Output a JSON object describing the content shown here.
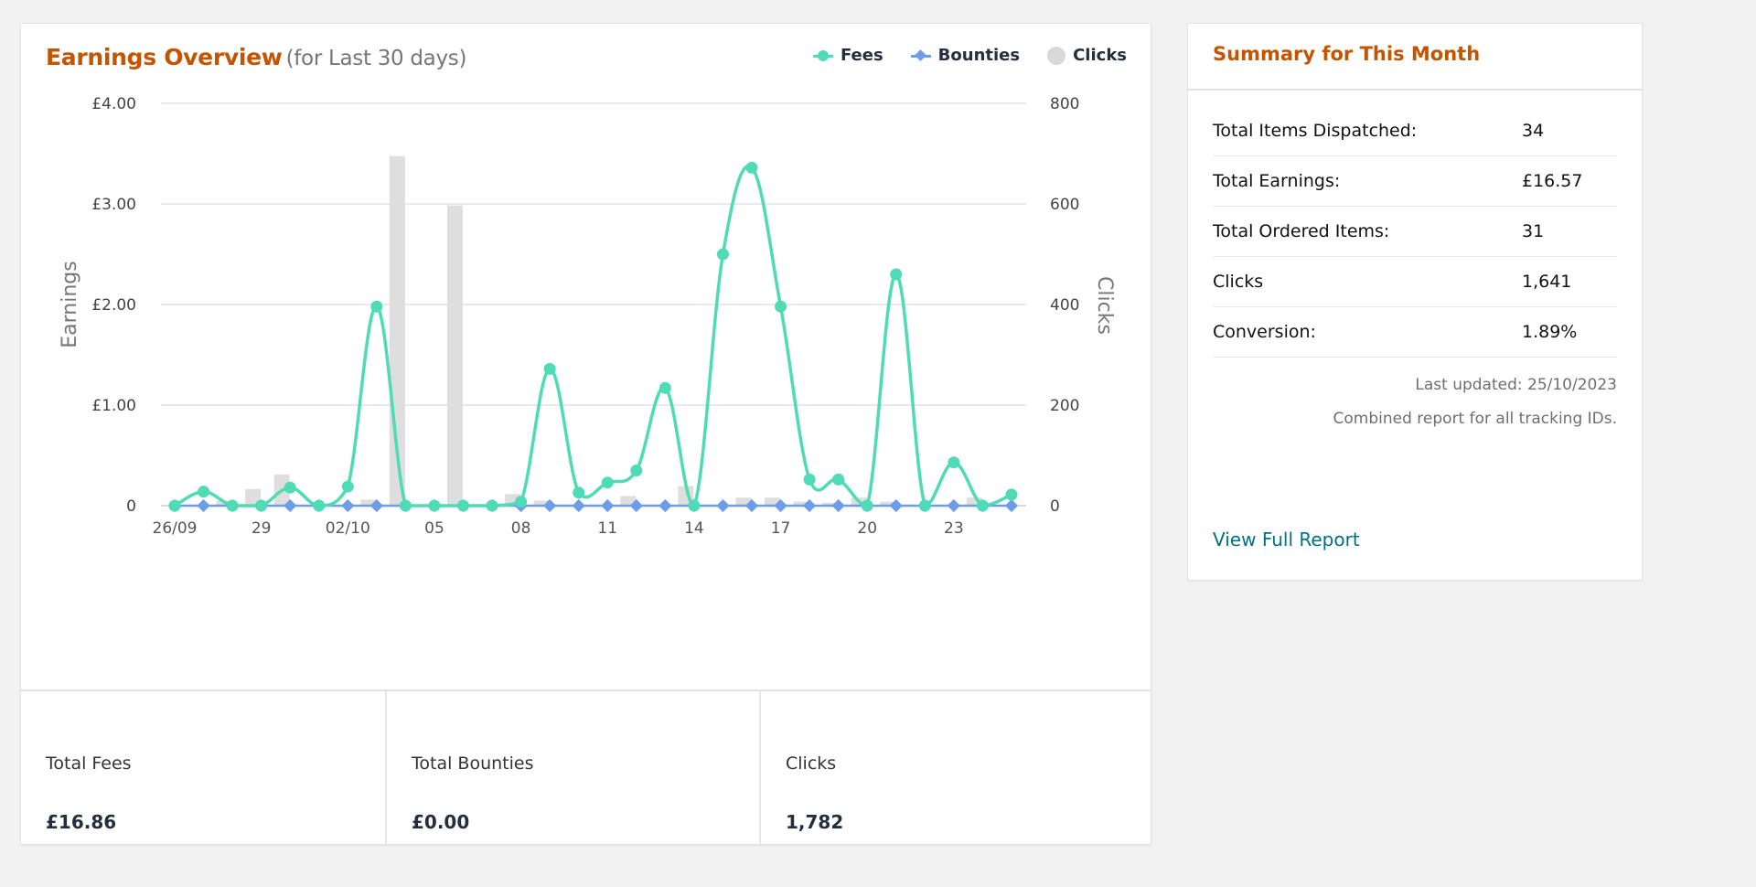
{
  "earnings_card": {
    "title": "Earnings Overview",
    "subtitle": "(for Last 30 days)",
    "legend": [
      {
        "label": "Fees",
        "icon": "line-circle-marker",
        "color": "#4fdbb5"
      },
      {
        "label": "Bounties",
        "icon": "line-diamond-marker",
        "color": "#6b9de8"
      },
      {
        "label": "Clicks",
        "icon": "circle",
        "color": "#d9d9d9"
      }
    ],
    "stats": [
      {
        "label": "Total Fees",
        "value": "£16.86"
      },
      {
        "label": "Total Bounties",
        "value": "£0.00"
      },
      {
        "label": "Clicks",
        "value": "1,782"
      }
    ]
  },
  "chart_data": {
    "type": "line",
    "title": "Earnings Overview",
    "xlabel": "",
    "ylabel": "Earnings",
    "y2label": "Clicks",
    "ylim": [
      0,
      4
    ],
    "y2lim": [
      0,
      800
    ],
    "yticks": [
      "0",
      "£1.00",
      "£2.00",
      "£3.00",
      "£4.00"
    ],
    "yticks_values": [
      0,
      1,
      2,
      3,
      4
    ],
    "y2ticks": [
      "0",
      "200",
      "400",
      "600",
      "800"
    ],
    "y2ticks_values": [
      0,
      200,
      400,
      600,
      800
    ],
    "grid": true,
    "legend_position": "top-right",
    "x": [
      "26/09",
      "27/09",
      "28/09",
      "29/09",
      "30/09",
      "01/10",
      "02/10",
      "03/10",
      "04/10",
      "05/10",
      "06/10",
      "07/10",
      "08/10",
      "09/10",
      "10/10",
      "11/10",
      "12/10",
      "13/10",
      "14/10",
      "15/10",
      "16/10",
      "17/10",
      "18/10",
      "19/10",
      "20/10",
      "21/10",
      "22/10",
      "23/10",
      "24/10",
      "25/10"
    ],
    "xtick_labels": [
      {
        "index": 0,
        "label": "26/09"
      },
      {
        "index": 3,
        "label": "29"
      },
      {
        "index": 6,
        "label": "02/10"
      },
      {
        "index": 9,
        "label": "05"
      },
      {
        "index": 12,
        "label": "08"
      },
      {
        "index": 15,
        "label": "11"
      },
      {
        "index": 18,
        "label": "14"
      },
      {
        "index": 21,
        "label": "17"
      },
      {
        "index": 24,
        "label": "20"
      },
      {
        "index": 27,
        "label": "23"
      }
    ],
    "series": [
      {
        "name": "Fees",
        "type": "spline",
        "axis": "left",
        "color": "#4fdbb5",
        "values": [
          0,
          0.14,
          0,
          0,
          0.18,
          0,
          0.19,
          1.98,
          0,
          0,
          0,
          0,
          0.04,
          1.36,
          0.13,
          0.23,
          0.35,
          1.17,
          0,
          2.5,
          3.36,
          1.98,
          0.26,
          0.26,
          0,
          2.3,
          0,
          0.43,
          0,
          0.11
        ]
      },
      {
        "name": "Bounties",
        "type": "line",
        "axis": "left",
        "color": "#6b9de8",
        "values": [
          0,
          0,
          0,
          0,
          0,
          0,
          0,
          0,
          0,
          0,
          0,
          0,
          0,
          0,
          0,
          0,
          0,
          0,
          0,
          0,
          0,
          0,
          0,
          0,
          0,
          0,
          0,
          0,
          0,
          0
        ]
      },
      {
        "name": "Clicks",
        "type": "bar",
        "axis": "right",
        "color": "#dedede",
        "values": [
          0,
          10,
          33,
          62,
          0,
          0,
          12,
          695,
          0,
          597,
          0,
          23,
          10,
          0,
          0,
          19,
          0,
          39,
          0,
          16,
          16,
          8,
          6,
          16,
          8,
          0,
          0,
          16,
          0,
          0
        ]
      }
    ]
  },
  "summary": {
    "title": "Summary for This Month",
    "rows": [
      {
        "label": "Total Items Dispatched:",
        "value": "34"
      },
      {
        "label": "Total Earnings:",
        "value": "£16.57"
      },
      {
        "label": "Total Ordered Items:",
        "value": "31"
      },
      {
        "label": "Clicks",
        "value": "1,641"
      },
      {
        "label": "Conversion:",
        "value": "1.89%"
      }
    ],
    "last_updated": "Last updated: 25/10/2023",
    "note": "Combined report for all tracking IDs.",
    "link_label": "View Full Report"
  }
}
